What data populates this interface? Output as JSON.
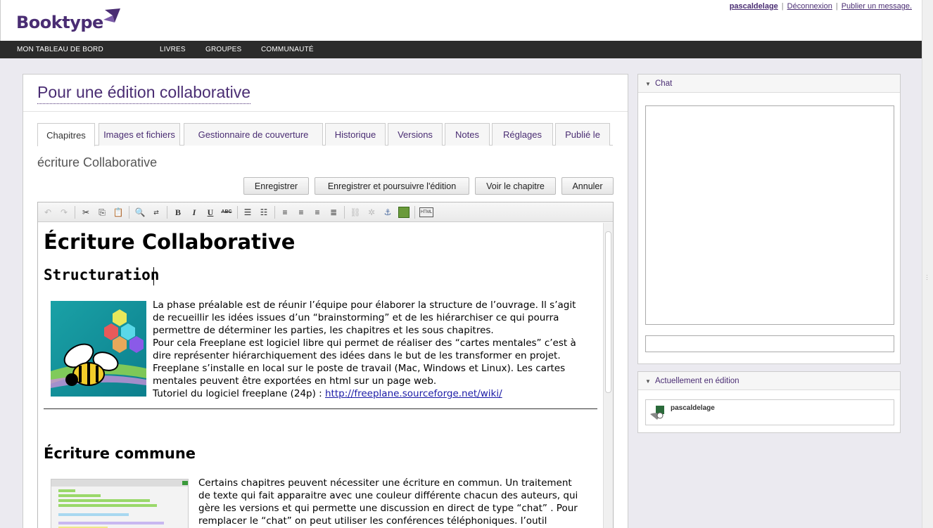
{
  "header": {
    "logo_text": "Booktype",
    "username": "pascaldelage",
    "logout_label": "Déconnexion",
    "publish_label": "Publier un message."
  },
  "nav": {
    "items": [
      {
        "label": "MON TABLEAU DE BORD"
      },
      {
        "label": "LIVRES"
      },
      {
        "label": "GROUPES"
      },
      {
        "label": "COMMUNAUTÉ"
      }
    ]
  },
  "book": {
    "title": "Pour une édition collaborative"
  },
  "tabs": [
    {
      "label": "Chapitres",
      "active": true
    },
    {
      "label": "Images et fichiers"
    },
    {
      "label": "Gestionnaire de couverture"
    },
    {
      "label": "Historique"
    },
    {
      "label": "Versions"
    },
    {
      "label": "Notes"
    },
    {
      "label": "Réglages"
    },
    {
      "label": "Publié le"
    }
  ],
  "chapter": {
    "title": "écriture Collaborative"
  },
  "buttons": {
    "save": "Enregistrer",
    "save_continue": "Enregistrer et poursuivre l'édition",
    "view": "Voir le chapitre",
    "cancel": "Annuler"
  },
  "toolbar": {
    "icons": [
      "undo-icon",
      "redo-icon",
      "cut-icon",
      "copy-icon",
      "paste-icon",
      "find-icon",
      "replace-icon",
      "bold-icon",
      "italic-icon",
      "underline-icon",
      "strikethrough-icon",
      "bullet-list-icon",
      "numbered-list-icon",
      "align-left-icon",
      "align-center-icon",
      "align-right-icon",
      "align-justify-icon",
      "link-icon",
      "unlink-icon",
      "anchor-icon",
      "image-icon",
      "html-source-icon"
    ],
    "bold_glyph": "B",
    "italic_glyph": "I",
    "underline_glyph": "U",
    "strike_glyph": "ABC",
    "source_glyph": "HTML"
  },
  "content": {
    "h1": "Écriture Collaborative",
    "h2_structuration": "Structuration",
    "p1": [
      "La phase préalable est de réunir l’équipe pour élaborer la structure de l’ouvrage. Il s’agit",
      "de recueillir les idées issues d’un “brainstorming” et de les hiérarchiser ce qui pourra",
      "permettre de déterminer les parties, les chapitres et les sous chapitres.",
      "Pour cela Freeplane est logiciel libre qui permet de réaliser des “cartes mentales” c’est à",
      "dire représenter hiérarchiquement des idées dans le but de les transformer en projet.",
      "Freeplane  s’installe en local sur le poste de travail (Mac, Windows et Linux). Les cartes",
      "mentales peuvent être exportées en html sur un page web."
    ],
    "tutorial_prefix": "Tutoriel du logiciel freeplane  (24p) : ",
    "tutorial_link": "http://freeplane.sourceforge.net/wiki/",
    "h2_commune": "Écriture commune",
    "p2": [
      "Certains chapitres peuvent nécessiter une écriture en commun. Un traitement",
      "de texte qui fait apparaitre avec une couleur différente chacun des auteurs, qui",
      "gère les versions et qui permette une discussion en direct de type “chat” . Pour",
      "remplacer le “chat” on peut utiliser les conférences téléphoniques. l’outil"
    ]
  },
  "chat": {
    "label": "Chat"
  },
  "editing": {
    "label": "Actuellement en édition",
    "user": "pascaldelage"
  },
  "colors": {
    "brand": "#4a2d73",
    "nav_bg": "#2b2b2b",
    "page_bg": "#ebeaf0",
    "link": "#1a1aa6"
  }
}
